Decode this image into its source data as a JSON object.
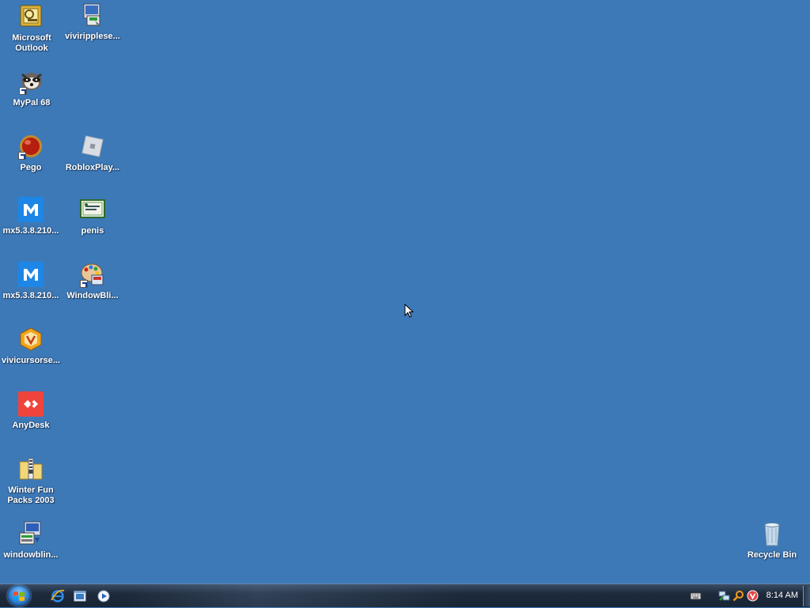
{
  "desktop": {
    "background_color": "#3d79b7",
    "icons": [
      {
        "label": "Microsoft Outlook",
        "icon": "outlook-icon"
      },
      {
        "label": "viviripplese...",
        "icon": "installer-icon"
      },
      {
        "label": "MyPal 68",
        "icon": "raccoon-browser-icon"
      },
      {
        "label": "Pego",
        "icon": "red-ball-icon"
      },
      {
        "label": "RobloxPlay...",
        "icon": "roblox-icon"
      },
      {
        "label": "mx5.3.8.210...",
        "icon": "maxthon-icon"
      },
      {
        "label": "penis",
        "icon": "certificate-icon"
      },
      {
        "label": "mx5.3.8.210...",
        "icon": "maxthon-icon"
      },
      {
        "label": "WindowBli...",
        "icon": "paint-palette-icon"
      },
      {
        "label": "vivicursorse...",
        "icon": "cursor-setup-icon"
      },
      {
        "label": "AnyDesk",
        "icon": "anydesk-icon"
      },
      {
        "label": "Winter Fun Packs 2003",
        "icon": "zip-folder-icon"
      },
      {
        "label": "windowblin...",
        "icon": "windowblinds-installer-icon"
      },
      {
        "label": "Recycle Bin",
        "icon": "recycle-bin-icon"
      }
    ]
  },
  "taskbar": {
    "start_button": "start-orb-icon",
    "quick_launch": [
      "internet-explorer-icon",
      "show-desktop-icon",
      "media-player-icon"
    ],
    "tray_icons": [
      "keyboard-icon",
      "network-icon",
      "search-icon",
      "antivirus-icon"
    ],
    "clock": "8:14 AM"
  }
}
